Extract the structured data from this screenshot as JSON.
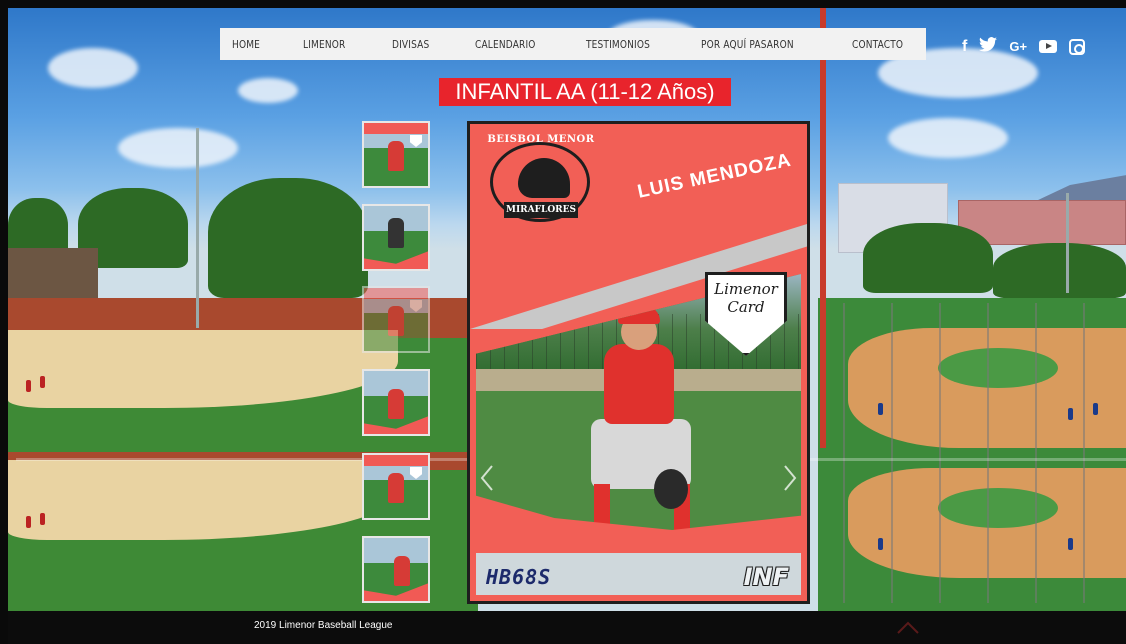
{
  "nav": {
    "items": [
      "HOME",
      "LIMENOR",
      "DIVISAS",
      "CALENDARIO",
      "TESTIMONIOS",
      "POR AQUÍ PASARON",
      "CONTACTO"
    ]
  },
  "social": {
    "icons": [
      "facebook-icon",
      "twitter-icon",
      "google-plus-icon",
      "youtube-icon",
      "instagram-icon"
    ],
    "facebook_glyph": "f",
    "google_glyph": "G+"
  },
  "page": {
    "title": "INFANTIL AA (11-12 Años)",
    "title_bg": "#e8242c"
  },
  "card": {
    "logo_top": "BEISBOL MENOR",
    "logo_bottom": "MIRAFLORES",
    "player_name": "LUIS MENDOZA",
    "badge_line1": "Limenor",
    "badge_line2": "Card",
    "code": "HB68S",
    "category": "INF",
    "accent": "#f25f56"
  },
  "gallery": {
    "thumbnail_count": 6,
    "selected_index": 2
  },
  "footer": {
    "copyright": "2019 Limenor Baseball League"
  }
}
